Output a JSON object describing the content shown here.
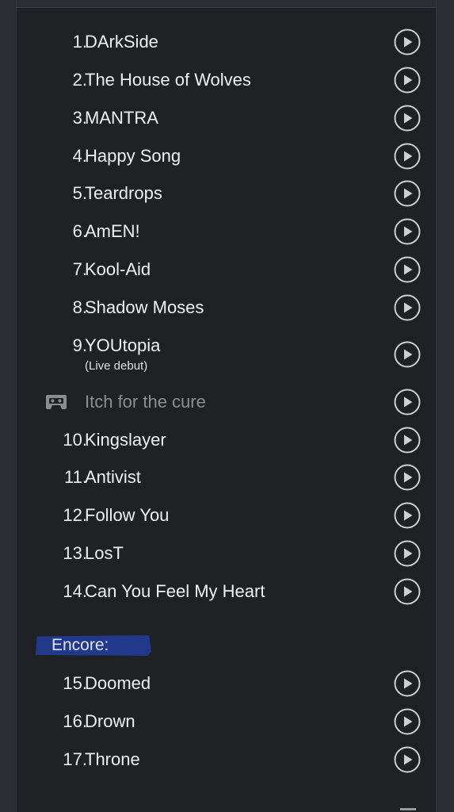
{
  "setlist": {
    "main_set": [
      {
        "number": "1.",
        "title": "DArkSide"
      },
      {
        "number": "2.",
        "title": "The House of Wolves"
      },
      {
        "number": "3.",
        "title": "MANTRA"
      },
      {
        "number": "4.",
        "title": "Happy Song"
      },
      {
        "number": "5.",
        "title": "Teardrops"
      },
      {
        "number": "6.",
        "title": "AmEN!"
      },
      {
        "number": "7.",
        "title": "Kool-Aid"
      },
      {
        "number": "8.",
        "title": "Shadow Moses"
      },
      {
        "number": "9.",
        "title": "YOUtopia",
        "note": "(Live debut)"
      },
      {
        "tape": true,
        "title": "Itch for the cure"
      },
      {
        "number": "10.",
        "title": "Kingslayer"
      },
      {
        "number": "11.",
        "title": "Antivist"
      },
      {
        "number": "12.",
        "title": "Follow You"
      },
      {
        "number": "13.",
        "title": "LosT"
      },
      {
        "number": "14.",
        "title": "Can You Feel My Heart"
      }
    ],
    "encore_label": "Encore:",
    "encore": [
      {
        "number": "15.",
        "title": "Doomed"
      },
      {
        "number": "16.",
        "title": "Drown"
      },
      {
        "number": "17.",
        "title": "Throne"
      }
    ],
    "icons": {
      "play": "play-circle-icon",
      "tape": "cassette-tape-icon"
    },
    "colors": {
      "background": "#1f2124",
      "encore_highlight": "#22388a",
      "muted_text": "#8b8d91"
    }
  }
}
